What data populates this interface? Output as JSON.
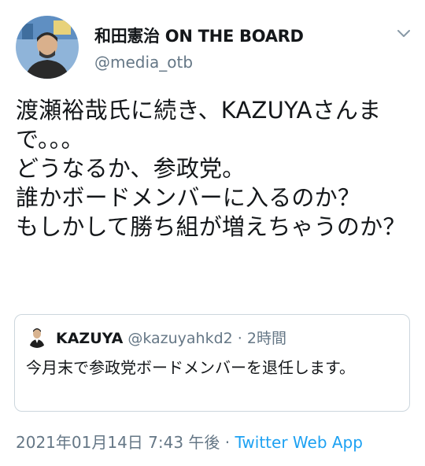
{
  "author": {
    "display_name": "和田憲治 ON THE BOARD",
    "handle": "@media_otb",
    "avatar_icon": "person-avatar-icon"
  },
  "tweet": {
    "text": "渡瀬裕哉氏に続き、KAZUYAさんまで。。。\nどうなるか、参政党。\n誰かボードメンバーに入るのか？\nもしかして勝ち組が増えちゃうのか？"
  },
  "quoted_tweet": {
    "name": "KAZUYA",
    "handle": "@kazuyahkd2",
    "separator": " · ",
    "time": "2時間",
    "text": "今月末で参政党ボードメンバーを退任します。"
  },
  "footer": {
    "timestamp": "2021年01月14日 7:43 午後",
    "separator": " · ",
    "source": "Twitter Web App"
  },
  "colors": {
    "text": "#14171a",
    "secondary": "#657786",
    "link": "#1da1f2",
    "border": "#ccd6dd"
  }
}
